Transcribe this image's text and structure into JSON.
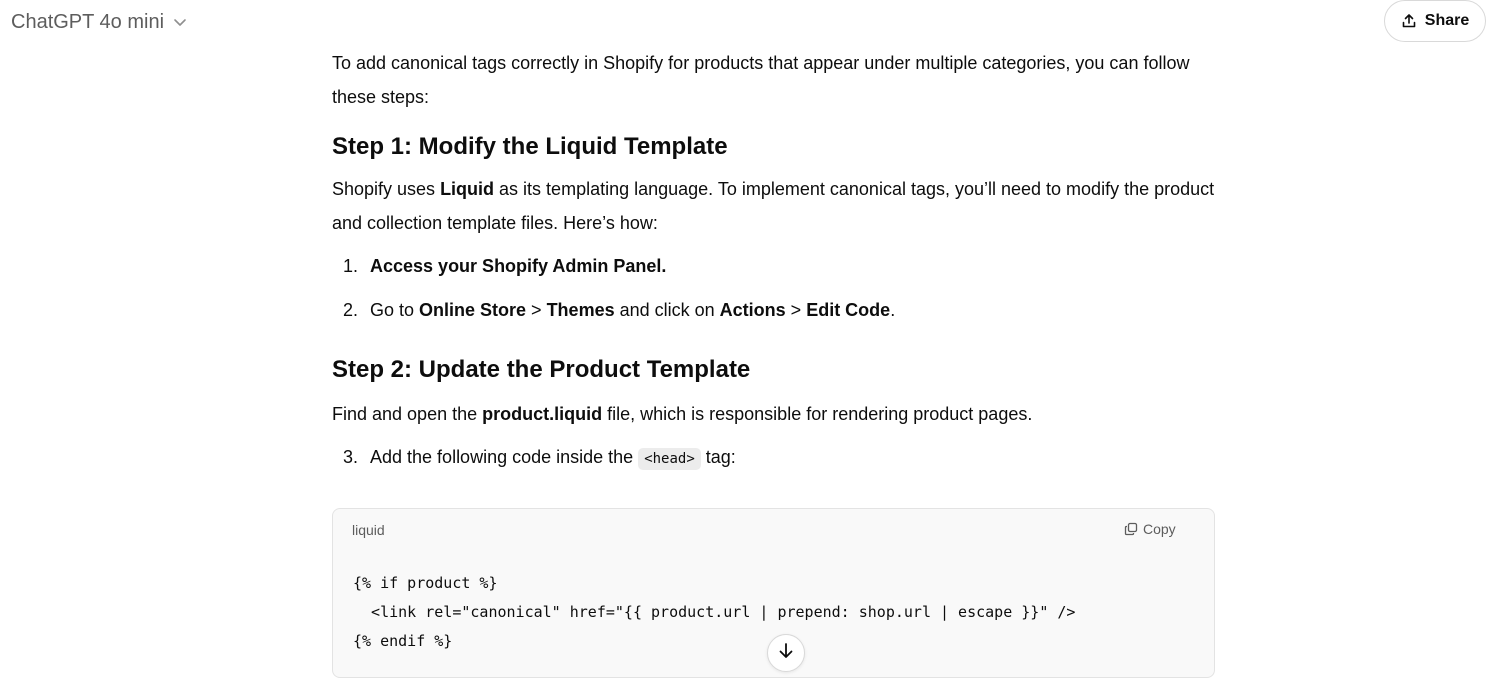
{
  "header": {
    "model_name": "ChatGPT 4o mini",
    "share_label": "Share"
  },
  "message": {
    "intro": "To add canonical tags correctly in Shopify for products that appear under multiple categories, you can follow these steps:",
    "step1_heading": "Step 1: Modify the Liquid Template",
    "step1_text_a": "Shopify uses ",
    "step1_text_bold": "Liquid",
    "step1_text_b": " as its templating language. To implement canonical tags, you’ll need to modify the product and collection template files. Here’s how:",
    "list1": [
      {
        "num": "1.",
        "bold": "Access your Shopify Admin Panel."
      },
      {
        "num": "2.",
        "t1": "Go to ",
        "b1": "Online Store",
        "t2": " > ",
        "b2": "Themes",
        "t3": " and click on ",
        "b3": "Actions",
        "t4": " > ",
        "b4": "Edit Code",
        "t5": "."
      }
    ],
    "step2_heading": "Step 2: Update the Product Template",
    "step2_text_a": "Find and open the ",
    "step2_text_bold": "product.liquid",
    "step2_text_b": " file, which is responsible for rendering product pages.",
    "list2": [
      {
        "num": "3.",
        "t1": "Add the following code inside the ",
        "code": "<head>",
        "t2": " tag:"
      }
    ]
  },
  "code_block": {
    "language": "liquid",
    "copy_label": "Copy",
    "lines": [
      "{% if product %}",
      "  <link rel=\"canonical\" href=\"{{ product.url | prepend: shop.url | escape }}\" />",
      "{% endif %}"
    ]
  }
}
